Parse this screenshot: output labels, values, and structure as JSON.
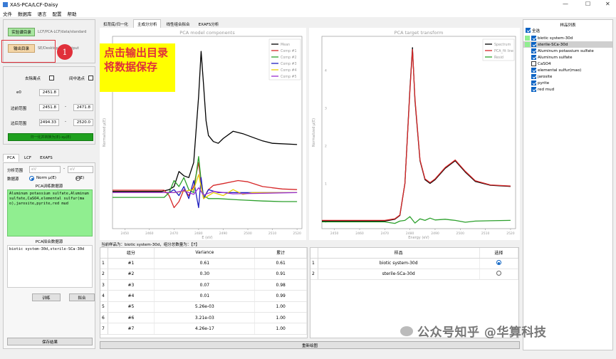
{
  "window": {
    "title": "XAS-PCA/LCF-Daisy"
  },
  "menu": [
    "文件",
    "数据库",
    "语言",
    "配置",
    "帮助"
  ],
  "left": {
    "exp_dir_button": "实验谱目录",
    "exp_dir_path": "LCF/PCA-LCF/data/standard",
    "output_dir_button": "输出目录",
    "output_dir_path": "SE/Desktop/LCF/output",
    "remove_outliers_label": "去除离点",
    "interp_label": "间中选点",
    "e0_label": "e0",
    "e0_value": "2451.8",
    "edge_range_label": "边前范围",
    "edge_lo": "2451.8",
    "edge_hi": "2471.8",
    "post_range_label": "边后范围",
    "post_lo": "2494.33",
    "post_hi": "2520.0",
    "normalize_button": "归一化并转换为(E)-xμ(E)",
    "tabs": [
      "PCA",
      "LCF",
      "EXAFS"
    ],
    "analysis_range_label": "分析范围",
    "range_lo_placeholder": "eV",
    "range_hi_placeholder": "eV",
    "data_source_label": "数据源",
    "radio_norm": "Norm μ(E)",
    "radio_mu": "μ(E)",
    "train_title": "PCA训练数据源",
    "train_text": "Aluminum potassium sulfate,Aluminum sulfate,CaSO4,elemental sulfur(mao),jarosite,pyrite,red mud",
    "fit_title": "PCA拟合数据源",
    "fit_text": "biotic system-30d,sterile-SCa-30d",
    "train_button": "训练",
    "fit_button": "拟合",
    "save_button": "保存结果"
  },
  "callout": {
    "number": "1",
    "text": "点击输出目录将数据保存"
  },
  "main": {
    "tabs": [
      "扣背底/归一化",
      "主成分分析",
      "线性组合拟合",
      "EXAFS分析"
    ],
    "status_line": "当前样品为：biotic system-30d，组分总数量为：【7】",
    "redraw_button": "重新绘图",
    "variance_headers": [
      "组分",
      "Variance",
      "累计"
    ],
    "variance_rows": [
      [
        "#1",
        "0.61",
        "0.61"
      ],
      [
        "#2",
        "0.30",
        "0.91"
      ],
      [
        "#3",
        "0.07",
        "0.98"
      ],
      [
        "#4",
        "0.01",
        "0.99"
      ],
      [
        "#5",
        "5.26e-03",
        "1.00"
      ],
      [
        "#6",
        "3.21e-03",
        "1.00"
      ],
      [
        "#7",
        "4.26e-17",
        "1.00"
      ]
    ],
    "sample_headers": [
      "样品",
      "选择"
    ],
    "sample_rows": [
      {
        "name": "biotic system-30d",
        "selected": true
      },
      {
        "name": "sterile-SCa-30d",
        "selected": false
      }
    ]
  },
  "sample_list": {
    "title": "样品列表",
    "select_all_label": "全选",
    "items": [
      {
        "name": "biotic system-30d",
        "color": "#90ee90",
        "checked": true
      },
      {
        "name": "sterile-SCa-30d",
        "color": "#90ee90",
        "checked": true
      },
      {
        "name": "Aluminum potassium sulfate",
        "color": "",
        "checked": true
      },
      {
        "name": "Aluminum sulfate",
        "color": "",
        "checked": true
      },
      {
        "name": "CaSO4",
        "color": "",
        "checked": false
      },
      {
        "name": "elemental sulfur(mao)",
        "color": "",
        "checked": true
      },
      {
        "name": "jarosite",
        "color": "",
        "checked": true
      },
      {
        "name": "pyrite",
        "color": "",
        "checked": true
      },
      {
        "name": "red mud",
        "color": "",
        "checked": true
      }
    ]
  },
  "watermark": "公众号知乎 @华算科技",
  "chart_data": [
    {
      "type": "line",
      "title": "PCA model components",
      "xlabel": "E (eV)",
      "ylabel": "Normalized μ(E)",
      "xlim": [
        2445,
        2522
      ],
      "ylim": [
        -0.6,
        2.6
      ],
      "xticks": [
        2450,
        2460,
        2470,
        2480,
        2490,
        2500,
        2510,
        2520
      ],
      "series": [
        {
          "name": "Mean",
          "color": "#000000",
          "x": [
            2445,
            2465,
            2468,
            2470,
            2472,
            2474,
            2476,
            2478,
            2480,
            2481,
            2482,
            2483,
            2484,
            2486,
            2488,
            2490,
            2494,
            2498,
            2502,
            2506,
            2510,
            2520
          ],
          "y": [
            0.02,
            0.02,
            0.05,
            0.1,
            0.35,
            0.28,
            0.25,
            0.5,
            1.6,
            2.35,
            1.8,
            1.2,
            0.95,
            0.85,
            0.82,
            0.9,
            1.02,
            0.98,
            0.92,
            0.86,
            0.82,
            0.8
          ]
        },
        {
          "name": "Comp #1",
          "color": "#d62728",
          "x": [
            2445,
            2466,
            2468,
            2470,
            2472,
            2474,
            2476,
            2478,
            2480,
            2481,
            2482,
            2484,
            2486,
            2490,
            2496,
            2500,
            2506,
            2514,
            2520
          ],
          "y": [
            0.04,
            0.04,
            -0.05,
            -0.25,
            -0.15,
            0.05,
            -0.05,
            0.1,
            0.5,
            0.15,
            -0.1,
            0.05,
            0.12,
            0.15,
            0.2,
            0.18,
            0.1,
            0.06,
            0.05
          ]
        },
        {
          "name": "Comp #2",
          "color": "#2ca02c",
          "x": [
            2445,
            2466,
            2468,
            2470,
            2472,
            2474,
            2476,
            2478,
            2480,
            2481,
            2482,
            2484,
            2488,
            2496,
            2506,
            2514,
            2520
          ],
          "y": [
            -0.08,
            -0.08,
            0.0,
            0.2,
            0.1,
            0.25,
            0.05,
            0.0,
            0.6,
            0.2,
            -0.05,
            -0.1,
            -0.1,
            -0.12,
            -0.14,
            -0.15,
            -0.15
          ]
        },
        {
          "name": "Comp #3",
          "color": "#1f1fbf",
          "x": [
            2445,
            2468,
            2470,
            2472,
            2474,
            2476,
            2478,
            2480,
            2481,
            2482,
            2484,
            2488,
            2496,
            2520
          ],
          "y": [
            0.0,
            0.0,
            0.05,
            -0.05,
            0.1,
            -0.1,
            0.2,
            -0.25,
            0.25,
            -0.1,
            0.05,
            0.0,
            0.0,
            0.0
          ]
        },
        {
          "name": "Comp #4",
          "color": "#e8d000",
          "x": [
            2445,
            2470,
            2474,
            2478,
            2480,
            2482,
            2486,
            2490,
            2494,
            2498,
            2502,
            2520
          ],
          "y": [
            0.0,
            0.0,
            0.02,
            0.05,
            0.3,
            -0.1,
            0.0,
            -0.05,
            0.05,
            -0.03,
            0.0,
            0.0
          ]
        },
        {
          "name": "Comp #5",
          "color": "#9b30d0",
          "x": [
            2445,
            2470,
            2474,
            2478,
            2480,
            2482,
            2486,
            2490,
            2494,
            2520
          ],
          "y": [
            0.0,
            0.0,
            0.03,
            -0.03,
            0.08,
            -0.04,
            0.02,
            0.0,
            -0.02,
            0.0
          ]
        }
      ]
    },
    {
      "type": "line",
      "title": "PCA target transform",
      "xlabel": "Energy (eV)",
      "ylabel": "Normalized μ(E)",
      "xlim": [
        2445,
        2522
      ],
      "ylim": [
        -0.2,
        4.9
      ],
      "xticks": [
        2450,
        2460,
        2470,
        2480,
        2490,
        2500,
        2510,
        2520
      ],
      "yticks": [
        0,
        1,
        2,
        3,
        4
      ],
      "series": [
        {
          "name": "Spectrum",
          "color": "#000000",
          "x": [
            2445,
            2470,
            2474,
            2476,
            2478,
            2480,
            2481,
            2482,
            2484,
            2486,
            2488,
            2490,
            2494,
            2498,
            2502,
            2506,
            2512,
            2520
          ],
          "y": [
            0.0,
            0.0,
            0.05,
            0.15,
            1.0,
            3.5,
            4.6,
            3.2,
            1.6,
            1.1,
            1.0,
            1.1,
            1.4,
            1.6,
            1.3,
            1.05,
            0.95,
            0.92
          ]
        },
        {
          "name": "PCA_fit line",
          "color": "#d62728",
          "x": [
            2445,
            2470,
            2474,
            2476,
            2478,
            2480,
            2481,
            2482,
            2484,
            2486,
            2488,
            2490,
            2494,
            2498,
            2502,
            2506,
            2512,
            2520
          ],
          "y": [
            0.02,
            0.02,
            0.06,
            0.16,
            1.0,
            3.45,
            4.55,
            3.25,
            1.62,
            1.12,
            1.02,
            1.12,
            1.42,
            1.62,
            1.32,
            1.07,
            0.96,
            0.93
          ]
        },
        {
          "name": "Resid",
          "color": "#2ca02c",
          "x": [
            2445,
            2470,
            2474,
            2476,
            2478,
            2480,
            2482,
            2484,
            2486,
            2488,
            2490,
            2494,
            2498,
            2502,
            2506,
            2512,
            2520
          ],
          "y": [
            -0.02,
            -0.02,
            -0.06,
            0.0,
            0.02,
            0.12,
            -0.05,
            0.06,
            0.02,
            0.08,
            0.03,
            0.05,
            0.02,
            -0.03,
            0.0,
            0.01,
            0.02
          ]
        }
      ]
    }
  ]
}
